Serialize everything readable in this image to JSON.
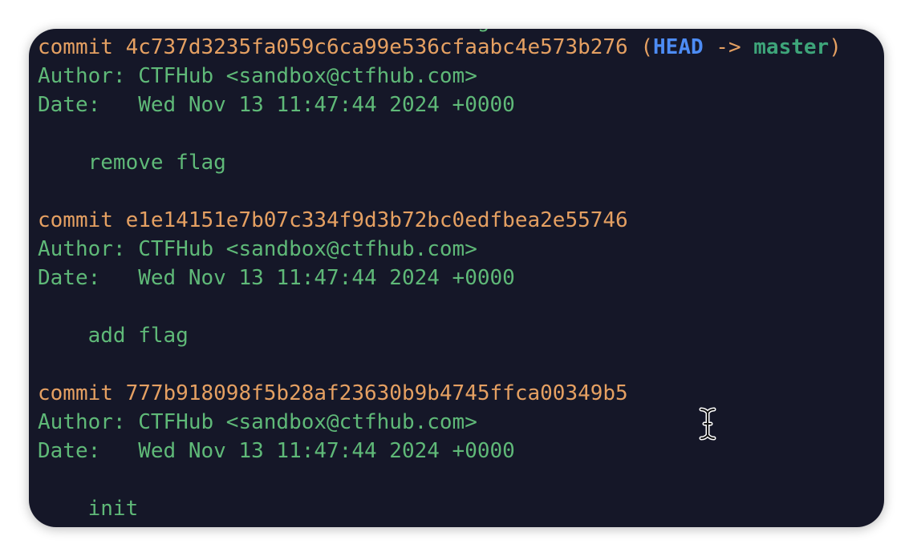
{
  "colors": {
    "background": "#151728",
    "commit_hash": "#e5a062",
    "text_green": "#5fb978",
    "head_ref": "#4d8cf5",
    "branch_ref": "#3ea57a"
  },
  "clipped_top_text": "                                   g",
  "commits": [
    {
      "commit_label": "commit 4c737d3235fa059c6ca99e536cfaabc4e573b276",
      "ref_open": " (",
      "ref_head": "HEAD",
      "ref_arrow": " -> ",
      "ref_branch": "master",
      "ref_close": ")",
      "author": "Author: CTFHub <sandbox@ctfhub.com>",
      "date": "Date:   Wed Nov 13 11:47:44 2024 +0000",
      "message": "    remove flag"
    },
    {
      "commit_label": "commit e1e14151e7b07c334f9d3b72bc0edfbea2e55746",
      "author": "Author: CTFHub <sandbox@ctfhub.com>",
      "date": "Date:   Wed Nov 13 11:47:44 2024 +0000",
      "message": "    add flag"
    },
    {
      "commit_label": "commit 777b918098f5b28af23630b9b4745ffca00349b5",
      "author": "Author: CTFHub <sandbox@ctfhub.com>",
      "date": "Date:   Wed Nov 13 11:47:44 2024 +0000",
      "message": "    init"
    }
  ],
  "cursor_icon": "text-cursor-icon"
}
